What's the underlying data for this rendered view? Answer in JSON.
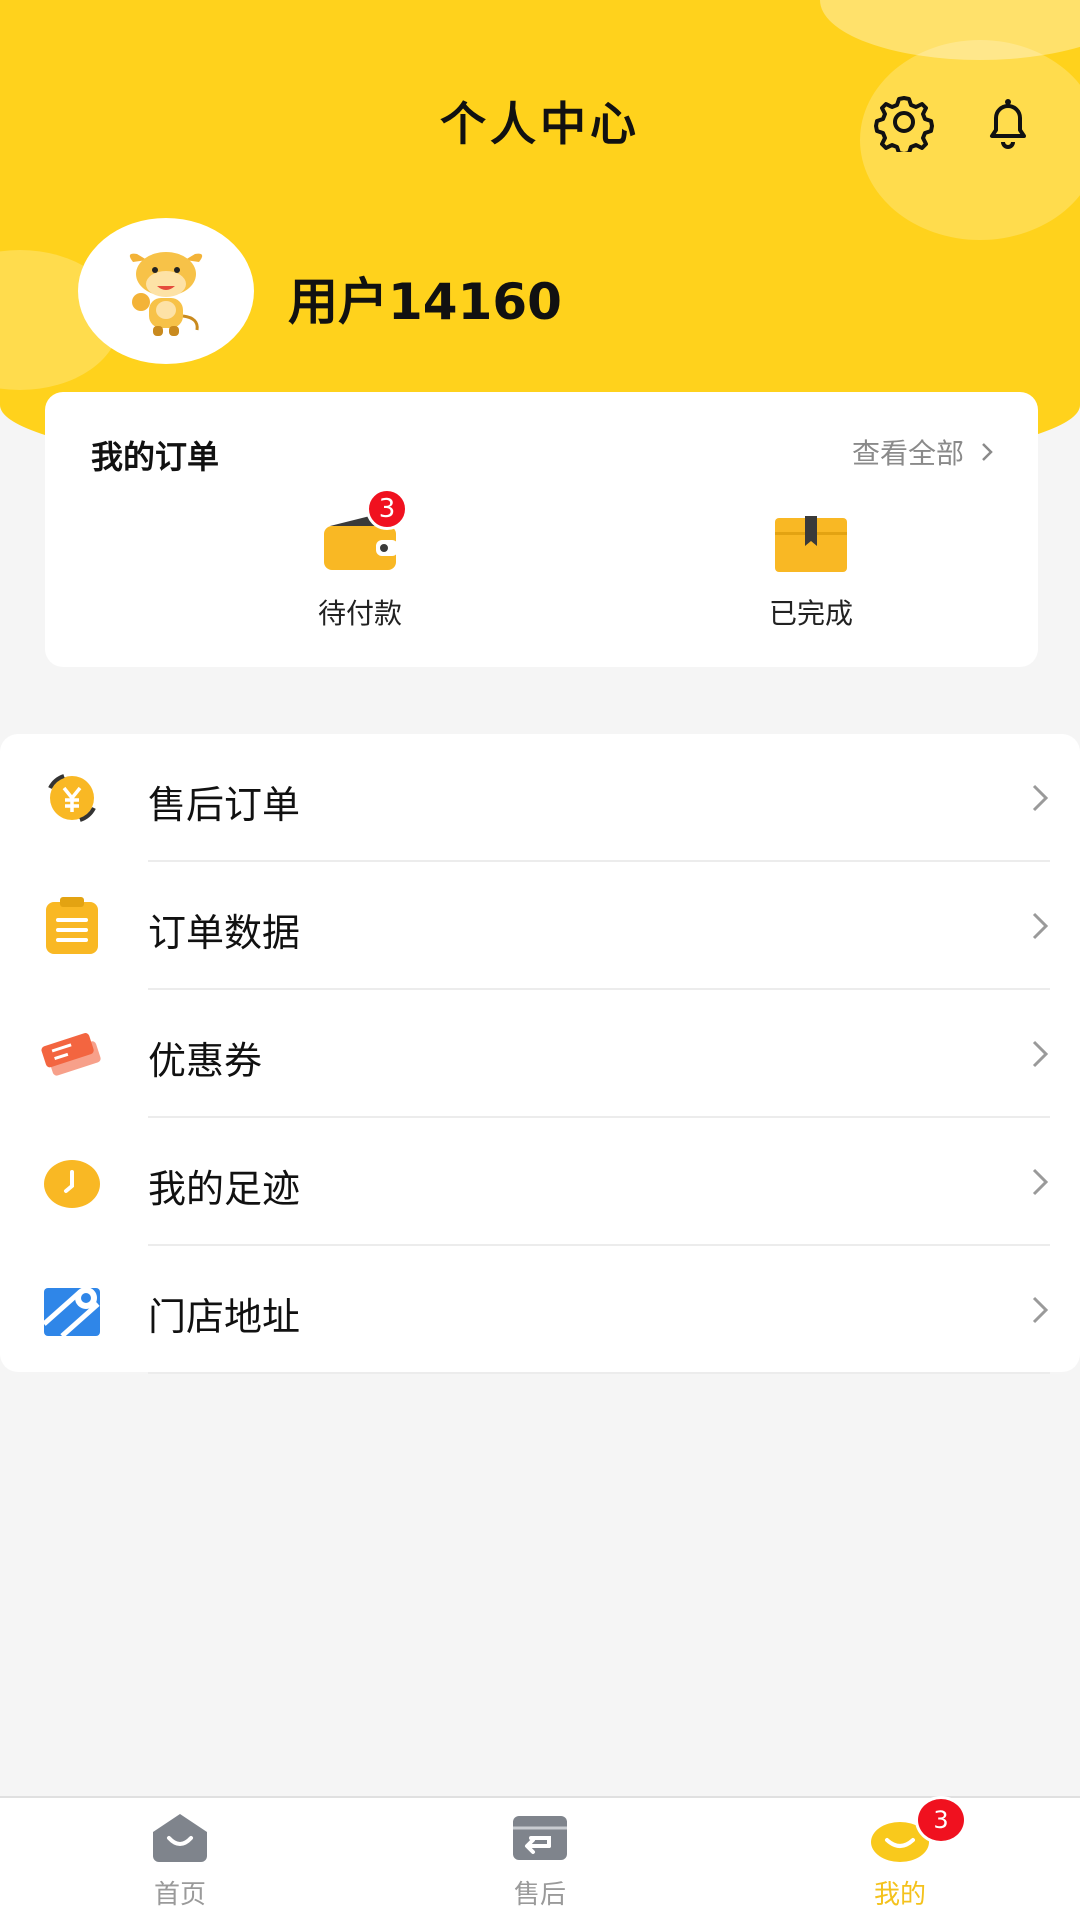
{
  "header": {
    "title": "个人中心",
    "username": "用户14160"
  },
  "orders": {
    "title": "我的订单",
    "view_all": "查看全部",
    "items": [
      {
        "label": "待付款",
        "badge": "3",
        "icon": "wallet-icon"
      },
      {
        "label": "已完成",
        "badge": null,
        "icon": "box-icon"
      }
    ]
  },
  "menu": {
    "items": [
      {
        "label": "售后订单",
        "icon": "yen-refresh-icon"
      },
      {
        "label": "订单数据",
        "icon": "clipboard-icon"
      },
      {
        "label": "优惠券",
        "icon": "coupon-icon"
      },
      {
        "label": "我的足迹",
        "icon": "clock-icon"
      },
      {
        "label": "门店地址",
        "icon": "map-pin-icon"
      }
    ]
  },
  "tabbar": {
    "items": [
      {
        "label": "首页",
        "icon": "home-icon"
      },
      {
        "label": "售后",
        "icon": "return-icon"
      },
      {
        "label": "我的",
        "icon": "profile-icon",
        "badge": "3",
        "active": true
      }
    ]
  },
  "colors": {
    "accent": "#ffd21c",
    "badge": "#f0111f",
    "icon_orange": "#f9b824",
    "coupon": "#f36540",
    "map_blue": "#2f86e8"
  }
}
